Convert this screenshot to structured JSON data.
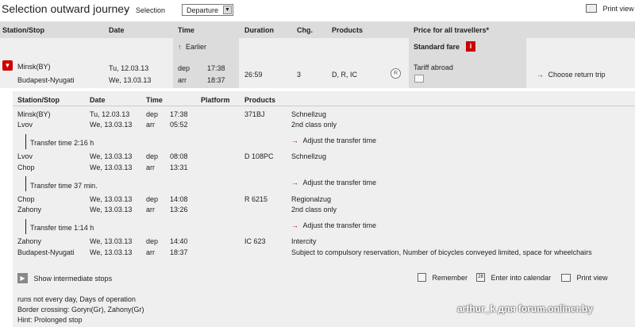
{
  "header": {
    "title": "Selection outward journey",
    "dash": "-",
    "selection_label": "Selection",
    "direction_select": "Departure",
    "print_view": "Print view"
  },
  "columns": {
    "station": "Station/Stop",
    "date": "Date",
    "time": "Time",
    "duration": "Duration",
    "changes": "Chg.",
    "products": "Products",
    "price": "Price for all travellers*"
  },
  "earlier": "Earlier",
  "standard_fare": "Standard fare",
  "journey": {
    "from": "Minsk(BY)",
    "to": "Budapest-Nyugati",
    "date_dep": "Tu, 12.03.13",
    "date_arr": "We, 13.03.13",
    "dep_label": "dep",
    "arr_label": "arr",
    "time_dep": "17:38",
    "time_arr": "18:37",
    "duration": "26:59",
    "changes": "3",
    "products": "D, R, IC",
    "tariff": "Tariff abroad",
    "choose_return": "Choose return trip"
  },
  "details_header": {
    "station": "Station/Stop",
    "date": "Date",
    "time": "Time",
    "platform": "Platform",
    "products": "Products"
  },
  "legs": [
    {
      "from": "Minsk(BY)",
      "to": "Lvov",
      "date_dep": "Tu, 12.03.13",
      "date_arr": "We, 13.03.13",
      "dep": "dep",
      "arr": "arr",
      "time_dep": "17:38",
      "time_arr": "05:52",
      "product": "371BJ",
      "info1": "Schnellzug",
      "info2": "2nd class only"
    },
    {
      "from": "Lvov",
      "to": "Chop",
      "date_dep": "We, 13.03.13",
      "date_arr": "We, 13.03.13",
      "dep": "dep",
      "arr": "arr",
      "time_dep": "08:08",
      "time_arr": "13:31",
      "product": "D 108PC",
      "info1": "Schnellzug",
      "info2": ""
    },
    {
      "from": "Chop",
      "to": "Zahony",
      "date_dep": "We, 13.03.13",
      "date_arr": "We, 13.03.13",
      "dep": "dep",
      "arr": "arr",
      "time_dep": "14:08",
      "time_arr": "13:26",
      "product": "R 6215",
      "info1": "Regionalzug",
      "info2": "2nd class only"
    },
    {
      "from": "Zahony",
      "to": "Budapest-Nyugati",
      "date_dep": "We, 13.03.13",
      "date_arr": "We, 13.03.13",
      "dep": "dep",
      "arr": "arr",
      "time_dep": "14:40",
      "time_arr": "18:37",
      "product": "IC 623",
      "info1": "Intercity",
      "info2": "Subject to compulsory reservation, Number of bicycles conveyed limited, space for wheelchairs"
    }
  ],
  "transfers": [
    {
      "label": "Transfer time 2:16 h",
      "adjust": "Adjust the transfer time"
    },
    {
      "label": "Transfer time 37 min.",
      "adjust": "Adjust the transfer time"
    },
    {
      "label": "Transfer time 1:14 h",
      "adjust": "Adjust the transfer time"
    }
  ],
  "actions": {
    "show_stops": "Show intermediate stops",
    "remember": "Remember",
    "calendar": "Enter into calendar",
    "print": "Print view"
  },
  "notes": {
    "line1": "runs not every day, Days of operation",
    "line2": "Border crossing: Goryn(Gr), Zahony(Gr)",
    "line3": "Hint: Prolonged stop"
  },
  "watermark": "arthur_k для forum.onliner.by",
  "colors": {
    "accent": "#cc0000",
    "header_gray": "#dcdcdc",
    "panel": "#efefef"
  }
}
